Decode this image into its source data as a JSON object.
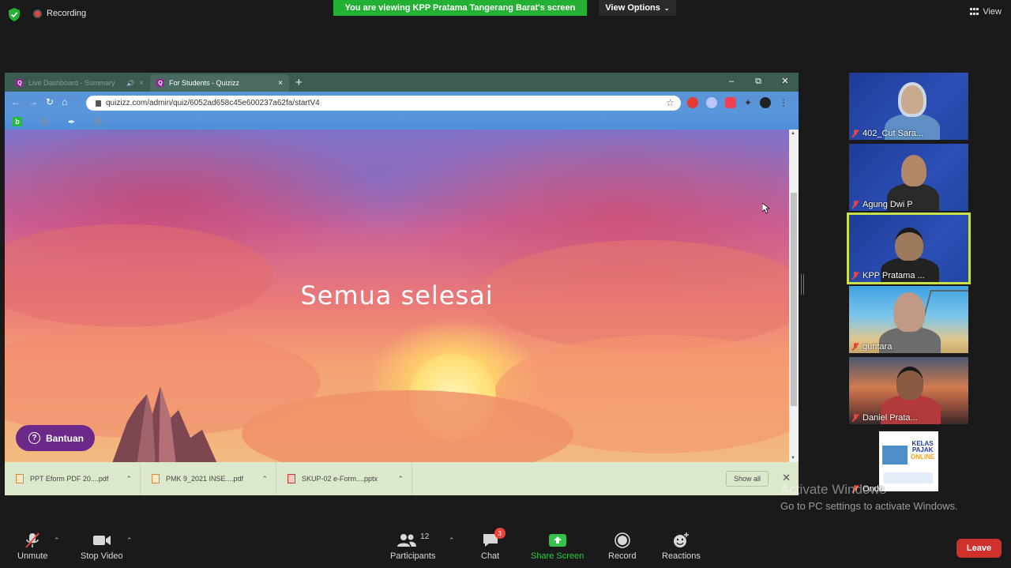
{
  "topbar": {
    "recording_label": "Recording",
    "share_banner": "You are viewing KPP Pratama Tangerang Barat's screen",
    "view_options": "View Options",
    "view_label": "View"
  },
  "browser": {
    "tabs": [
      {
        "label": "Live Dashboard - Summary",
        "active": false
      },
      {
        "label": "For Students - Quizizz",
        "active": true
      }
    ],
    "url": "quizizz.com/admin/quiz/6052ad658c45e600237a62fa/startV4",
    "bookmarks": [
      "",
      "",
      "",
      ""
    ],
    "page": {
      "headline": "Semua selesai",
      "help_button": "Bantuan"
    },
    "downloads": [
      {
        "name": "PPT Eform PDF 20....pdf",
        "type": "pdf"
      },
      {
        "name": "PMK 9_2021 INSE....pdf",
        "type": "pdf"
      },
      {
        "name": "SKUP-02 e-Form....pptx",
        "type": "pptx"
      }
    ],
    "show_all": "Show all"
  },
  "participants": [
    {
      "name": "402_Cut Sara...",
      "muted": true
    },
    {
      "name": "Agung Dwi P",
      "muted": true
    },
    {
      "name": "KPP Pratama ...",
      "muted": true,
      "active_speaker": true
    },
    {
      "name": "guntara",
      "muted": true
    },
    {
      "name": "Daniel Prata...",
      "muted": true
    },
    {
      "name": "Ondo",
      "muted": true
    }
  ],
  "kelas_pajak": {
    "line1": "KELAS",
    "line2": "PAJAK",
    "line3": "ONLINE"
  },
  "watermark": {
    "title": "Activate Windows",
    "subtitle": "Go to PC settings to activate Windows."
  },
  "toolbar": {
    "unmute": "Unmute",
    "stop_video": "Stop Video",
    "participants": "Participants",
    "participants_count": "12",
    "chat": "Chat",
    "chat_badge": "3",
    "share_screen": "Share Screen",
    "record": "Record",
    "reactions": "Reactions",
    "leave": "Leave"
  },
  "colors": {
    "share_green": "#23b033",
    "leave_red": "#d0312d",
    "active_speaker": "#c8e04a",
    "quizizz_purple": "#6b2a8a"
  }
}
